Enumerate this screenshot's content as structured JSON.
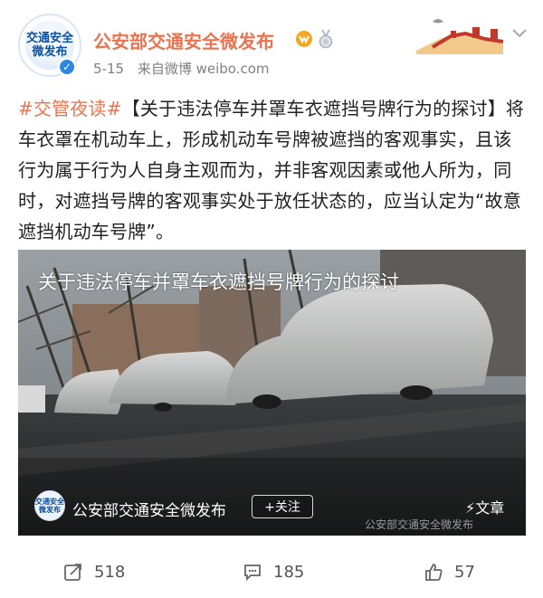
{
  "header": {
    "avatar_lines": [
      "交通安全",
      "微发布"
    ],
    "author_name": "公安部交通安全微发布",
    "date": "5-15",
    "source": "来自微博 weibo.com"
  },
  "post": {
    "hashtag": "#交管夜读#",
    "text": "【关于违法停车并罩车衣遮挡号牌行为的探讨】将车衣罩在机动车上，形成机动车号牌被遮挡的客观事实，且该行为属于行为人自身主观而为，并非客观因素或他人所为，同时，对遮挡号牌的客观事实处于放任状态的，应当认定为“故意遮挡机动车号牌”。"
  },
  "image": {
    "caption": "关于违法停车并罩车衣遮挡号牌行为的探讨",
    "footer_avatar_lines": [
      "交通安全",
      "微发布"
    ],
    "footer_name": "公安部交通安全微发布",
    "follow_label": "+关注",
    "article_label": "⚡文章",
    "watermark": "公安部交通安全微发布"
  },
  "actions": {
    "repost_count": "518",
    "comment_count": "185",
    "like_count": "57"
  },
  "colors": {
    "accent": "#eb7350",
    "verify": "#2e86de",
    "meta_text": "#808080"
  },
  "icons": [
    "verified-icon",
    "vip-badge-icon",
    "medal-icon",
    "chevron-down-icon",
    "repost-icon",
    "comment-icon",
    "like-icon"
  ]
}
